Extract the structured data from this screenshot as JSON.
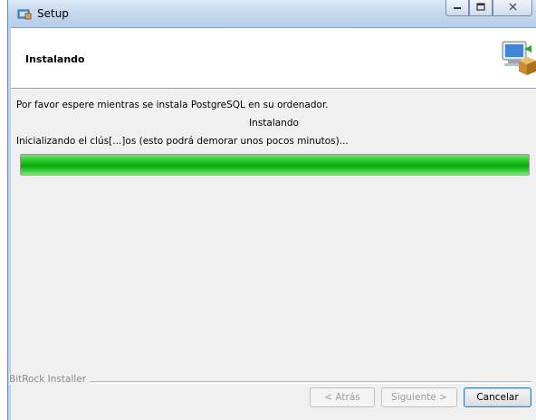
{
  "window": {
    "title": "Setup"
  },
  "header": {
    "title": "Instalando"
  },
  "body": {
    "message": "Por favor espere mientras se instala PostgreSQL en su ordenador.",
    "status": "Instalando",
    "detail": "Inicializando el clús[...]os (esto podrá demorar unos pocos minutos)..."
  },
  "progress": {
    "percent": 100
  },
  "footer": {
    "brand": "BitRock Installer",
    "back_label": "< Atrás",
    "next_label": "Siguiente >",
    "cancel_label": "Cancelar"
  },
  "icons": {
    "app": "setup-icon",
    "header": "computer-package-icon",
    "minimize": "minimize-icon",
    "maximize": "maximize-icon",
    "close": "close-icon"
  },
  "colors": {
    "progress": "#1ec41e",
    "titlebar": "#c6d9ef"
  }
}
